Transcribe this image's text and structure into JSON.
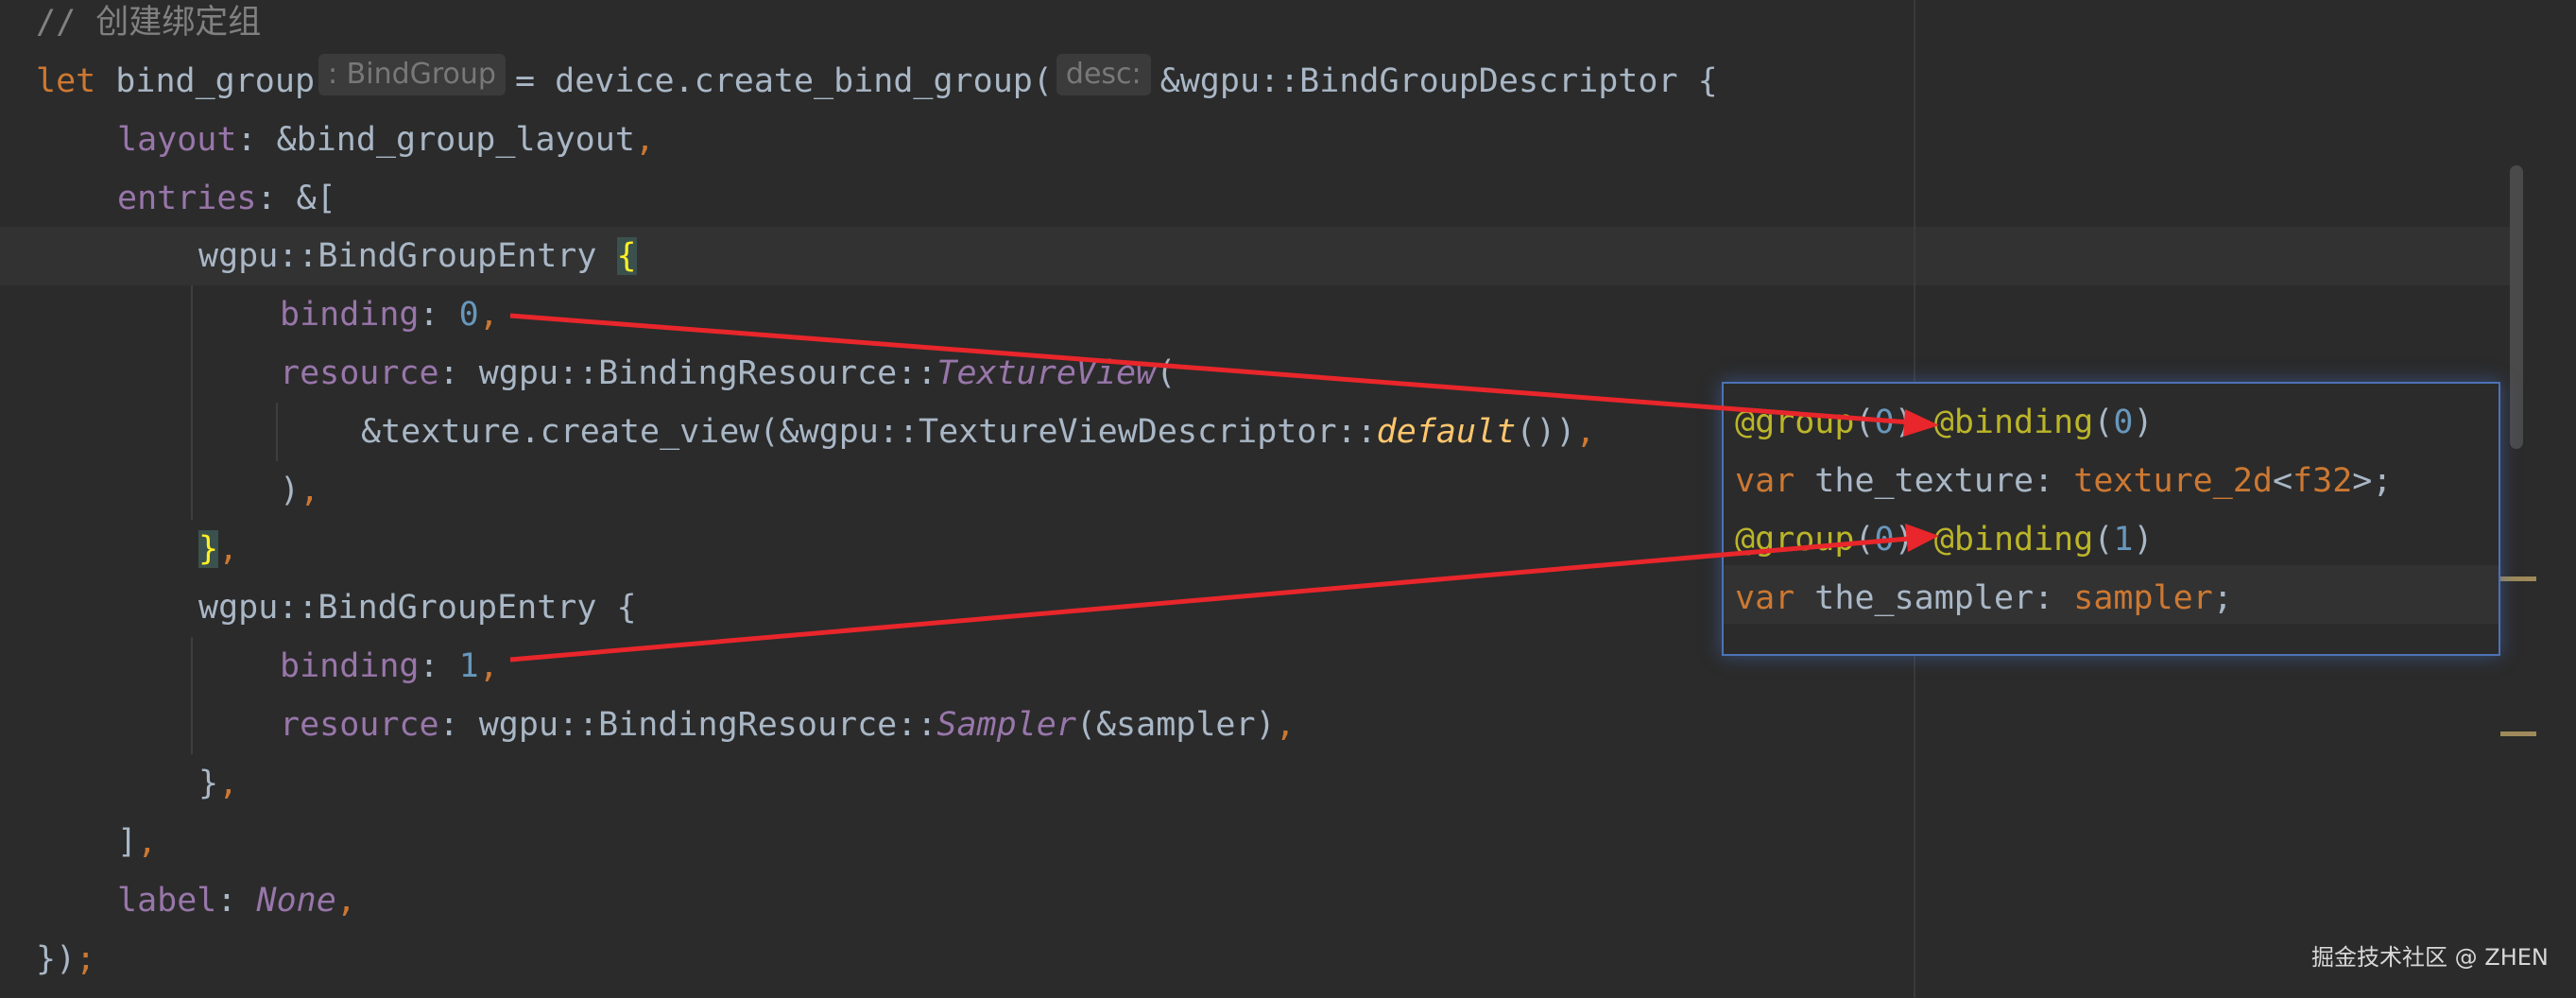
{
  "editor": {
    "comment": "// 创建绑定组",
    "line1": {
      "kw_let": "let",
      "var_name": "bind_group",
      "type_hint": ": BindGroup",
      "assign": "=",
      "call": "device.create_bind_group(",
      "param_hint": "desc:",
      "descriptor": "&wgpu::BindGroupDescriptor {"
    },
    "layout": {
      "field": "layout",
      "sep": ":",
      "value": "&bind_group_layout",
      "comma": ","
    },
    "entries": {
      "field": "entries",
      "sep": ":",
      "value": "&["
    },
    "entry0": {
      "type": "wgpu::BindGroupEntry",
      "brace_open": "{",
      "binding_field": "binding",
      "binding_value": "0",
      "resource_field": "resource",
      "resource_path": "wgpu::BindingResource::",
      "resource_variant": "TextureView",
      "resource_paren": "(",
      "create_view": "&texture.create_view(&wgpu::TextureViewDescriptor::",
      "default_fn": "default",
      "create_view_tail": "())",
      "close_paren": ")",
      "brace_close": "}"
    },
    "entry1": {
      "type": "wgpu::BindGroupEntry",
      "brace_open": "{",
      "binding_field": "binding",
      "binding_value": "1",
      "resource_field": "resource",
      "resource_path": "wgpu::BindingResource::",
      "resource_variant": "Sampler",
      "resource_args": "(&sampler)",
      "brace_close": "}"
    },
    "entries_close": "]",
    "label": {
      "field": "label",
      "sep": ":",
      "value": "None"
    },
    "closing": "})",
    "closing_semi": ";"
  },
  "popup": {
    "line0": {
      "group": "@group",
      "open": "(",
      "group_idx": "0",
      "close": ")",
      "binding": "@binding",
      "binding_idx": "0"
    },
    "line1": {
      "kw": "var",
      "name": "the_texture",
      "colon": ":",
      "type": "texture_2d",
      "lt": "<",
      "generic": "f32",
      "gt": ">",
      "semi": ";"
    },
    "line2": {
      "group": "@group",
      "open": "(",
      "group_idx": "0",
      "close": ")",
      "binding": "@binding",
      "binding_idx": "1"
    },
    "line3": {
      "kw": "var",
      "name": "the_sampler",
      "colon": ":",
      "type": "sampler",
      "semi": ";"
    }
  },
  "watermark": "掘金技术社区 @ ZHEN",
  "colors": {
    "background": "#2b2b2b",
    "keyword": "#cc7832",
    "field": "#9876aa",
    "number": "#6897bb",
    "annotation": "#bbb529",
    "default_fn": "#ffc66d",
    "popup_border": "#4d72b5",
    "arrow": "#e8262b"
  }
}
